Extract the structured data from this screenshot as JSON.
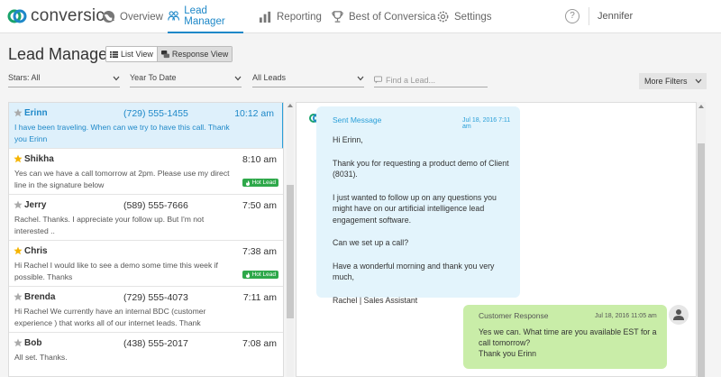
{
  "app": {
    "brand": "conversica"
  },
  "nav": {
    "items": [
      {
        "label": "Overview",
        "icon": "globe-icon"
      },
      {
        "label": "Lead Manager",
        "icon": "people-icon"
      },
      {
        "label": "Reporting",
        "icon": "bar-chart-icon"
      },
      {
        "label": "Best of Conversica",
        "icon": "trophy-icon"
      },
      {
        "label": "Settings",
        "icon": "gear-icon"
      }
    ],
    "active": "Lead Manager",
    "help": "?",
    "user": "Jennifer"
  },
  "header": {
    "title": "Lead Manager",
    "views": [
      {
        "label": "List View"
      },
      {
        "label": "Response View"
      }
    ],
    "active_view": "Response View"
  },
  "filters": {
    "stars": "Stars: All",
    "period": "Year To Date",
    "leads": "All Leads",
    "find_placeholder": "Find a Lead...",
    "more": "More Filters"
  },
  "leads": [
    {
      "name": "Erinn",
      "phone": "(729) 555-1455",
      "time": "10:12 am",
      "message": "I have been traveling. When can we try to have this call. Thank you Erinn",
      "starred": false,
      "hot": false,
      "selected": true
    },
    {
      "name": "Shikha",
      "phone": "",
      "time": "8:10 am",
      "message": "Yes can we have a call tomorrow at 2pm. Please use my direct line in the signature below",
      "starred": true,
      "hot": true,
      "selected": false
    },
    {
      "name": "Jerry",
      "phone": "(589) 555-7666",
      "time": "7:50 am",
      "message": "Rachel. Thanks. I appreciate your follow up. But I'm not interested ..",
      "starred": false,
      "hot": false,
      "selected": false
    },
    {
      "name": "Chris",
      "phone": "",
      "time": "7:38 am",
      "message": "Hi Rachel I would like to see a demo some time this week if possible. Thanks",
      "starred": true,
      "hot": true,
      "selected": false
    },
    {
      "name": "Brenda",
      "phone": "(729) 555-4073",
      "time": "7:11 am",
      "message": "Hi Rachel We currently have an internal BDC (customer experience ) that works all of our internet leads. Thank",
      "starred": false,
      "hot": false,
      "selected": false
    },
    {
      "name": "Bob",
      "phone": "(438) 555-2017",
      "time": "7:08 am",
      "message": "All set. Thanks.",
      "starred": false,
      "hot": false,
      "selected": false
    }
  ],
  "hot_label": "Hot Lead",
  "conversation": {
    "sent": {
      "label": "Sent Message",
      "date": "Jul 18, 2016 7:11 am",
      "paragraphs": [
        "Hi Erinn,",
        "Thank you for requesting a product demo of Client (8031).",
        "I just wanted to follow up on any questions you might have on our artificial intelligence lead engagement software.",
        "Can we set up a call?",
        "Have a wonderful morning and thank you very much,",
        "Rachel | Sales Assistant"
      ]
    },
    "response": {
      "label": "Customer Response",
      "date": "Jul 18, 2016 11:05 am",
      "lines": [
        "Yes we can. What time are you available EST for a call tomorrow?",
        "Thank you Erinn"
      ]
    }
  },
  "colors": {
    "accent": "#1e88c8",
    "hot": "#2ea84a",
    "sent_bg": "#e3f4fc",
    "response_bg": "#c9eda8",
    "star": "#f5b400"
  }
}
